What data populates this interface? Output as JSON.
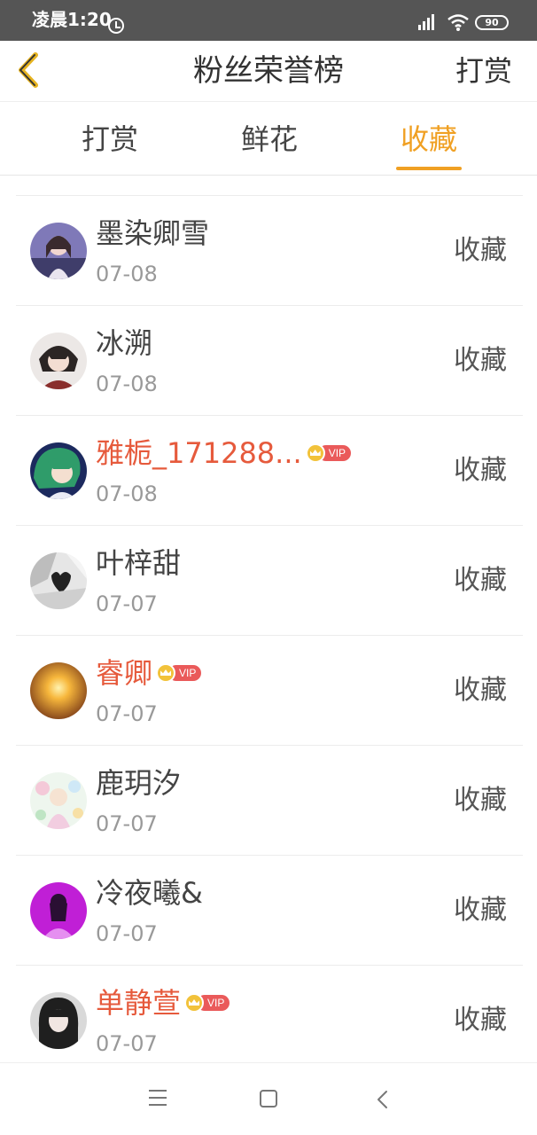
{
  "status_bar": {
    "time": "凌晨1:20",
    "battery": "90"
  },
  "header": {
    "title": "粉丝荣誉榜",
    "action_label": "打赏"
  },
  "tabs": [
    {
      "label": "打赏"
    },
    {
      "label": "鲜花"
    },
    {
      "label": "收藏",
      "active": true
    }
  ],
  "vip_label": "VIP",
  "list": [
    {
      "name": "墨染卿雪",
      "date": "07-08",
      "action": "收藏",
      "vip": false
    },
    {
      "name": "冰溯",
      "date": "07-08",
      "action": "收藏",
      "vip": false
    },
    {
      "name": "雅栀_171288...",
      "date": "07-08",
      "action": "收藏",
      "vip": true
    },
    {
      "name": "叶梓甜",
      "date": "07-07",
      "action": "收藏",
      "vip": false
    },
    {
      "name": "睿卿",
      "date": "07-07",
      "action": "收藏",
      "vip": true
    },
    {
      "name": "鹿玥汐",
      "date": "07-07",
      "action": "收藏",
      "vip": false
    },
    {
      "name": "冷夜曦&",
      "date": "07-07",
      "action": "收藏",
      "vip": false
    },
    {
      "name": "单静萱",
      "date": "07-07",
      "action": "收藏",
      "vip": true
    }
  ],
  "colors": {
    "accent": "#f0a023",
    "vip_name": "#e65a3c",
    "vip_badge": "#ea5a5a"
  }
}
